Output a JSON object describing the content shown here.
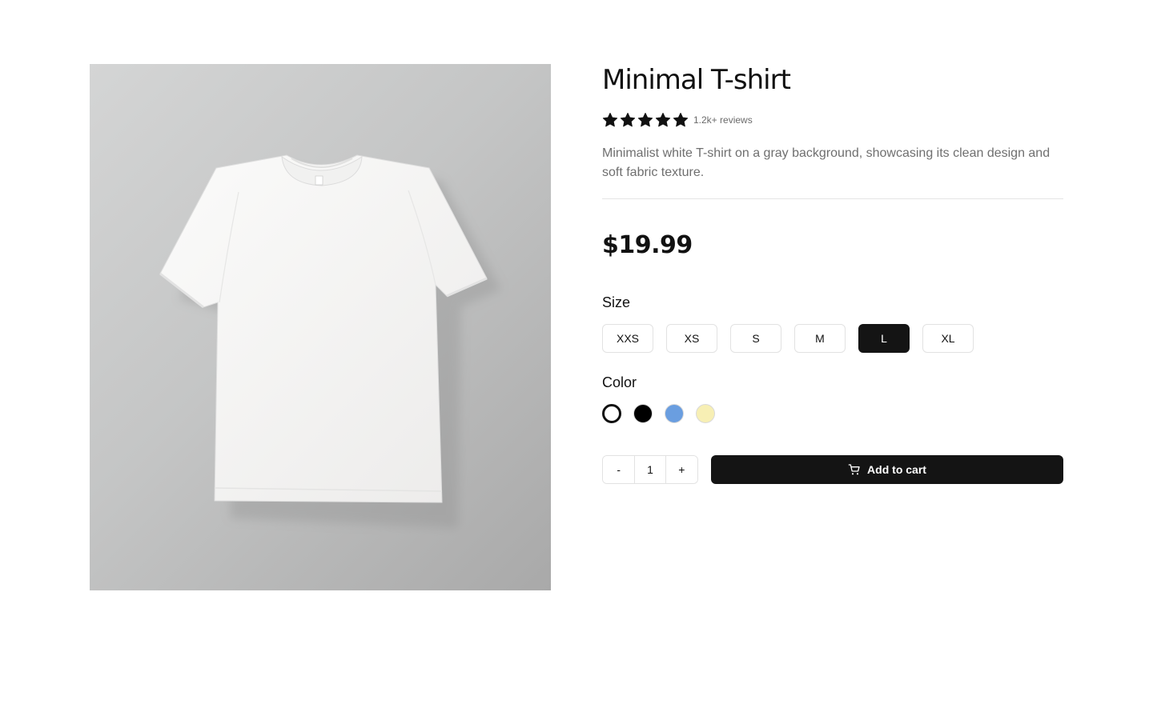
{
  "product": {
    "title": "Minimal T-shirt",
    "rating": 5,
    "reviews_text": "1.2k+ reviews",
    "description": "Minimalist white T-shirt on a gray background, showcasing its clean design and soft fabric texture.",
    "price": "$19.99"
  },
  "size": {
    "label": "Size",
    "options": [
      "XXS",
      "XS",
      "S",
      "M",
      "L",
      "XL"
    ],
    "selected": "L"
  },
  "color": {
    "label": "Color",
    "options": [
      "#ffffff",
      "#000000",
      "#6a9ee0",
      "#f7efb4"
    ],
    "selected": "#ffffff"
  },
  "quantity": {
    "decrement_label": "-",
    "value": "1",
    "increment_label": "+"
  },
  "cart": {
    "button_label": "Add to cart",
    "icon": "cart-icon"
  },
  "icons": {
    "star": "star-icon"
  }
}
